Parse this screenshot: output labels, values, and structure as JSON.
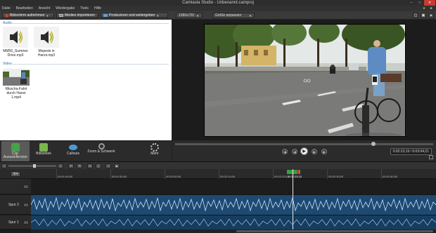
{
  "window": {
    "title": "Camtasia Studio - Unbenannt.camproj"
  },
  "menu": [
    "Datei",
    "Bearbeiten",
    "Ansicht",
    "Wiedergabe",
    "Tools",
    "Hilfe"
  ],
  "toolbar": {
    "record_label": "Bildschirm aufnehmen",
    "import_label": "Medien importieren",
    "produce_label": "Produzieren und weitergeben",
    "resolution": "1280x720",
    "fit": "Größe anpassen"
  },
  "clip_bin": {
    "audio_section": "Audio",
    "video_section": "Video",
    "audio_items": [
      {
        "name": "MM56_Summer Drive.mp3"
      },
      {
        "name": "Mopeds in Hanoi.mp3"
      }
    ],
    "video_items": [
      {
        "name": "Rikscha-Fahrt durch Hanoi 1.mp4"
      }
    ]
  },
  "tabs": [
    {
      "label": "Clip-Auswahlfenster"
    },
    {
      "label": "Bibliothek"
    },
    {
      "label": "Callouts"
    },
    {
      "label": "Zoom & Schwenk"
    },
    {
      "label": "Mehr"
    }
  ],
  "player": {
    "timecode": "0:02:23;19 / 0:03:04;21"
  },
  "timeline": {
    "ticks": [
      "00:01:40;00",
      "00:01:50;00",
      "00:02:00;00",
      "00:02:10;00",
      "00:02:20;00",
      "00:02:30;00",
      "00:02:40;00"
    ],
    "playhead_label": "0:02:23;15",
    "tracks": [
      {
        "name": "Spur 2"
      },
      {
        "name": "Spur 1"
      }
    ]
  },
  "colors": {
    "accent_green": "#36a040",
    "clip_blue": "#1c4a73",
    "section_blue": "#2a6ebb"
  }
}
